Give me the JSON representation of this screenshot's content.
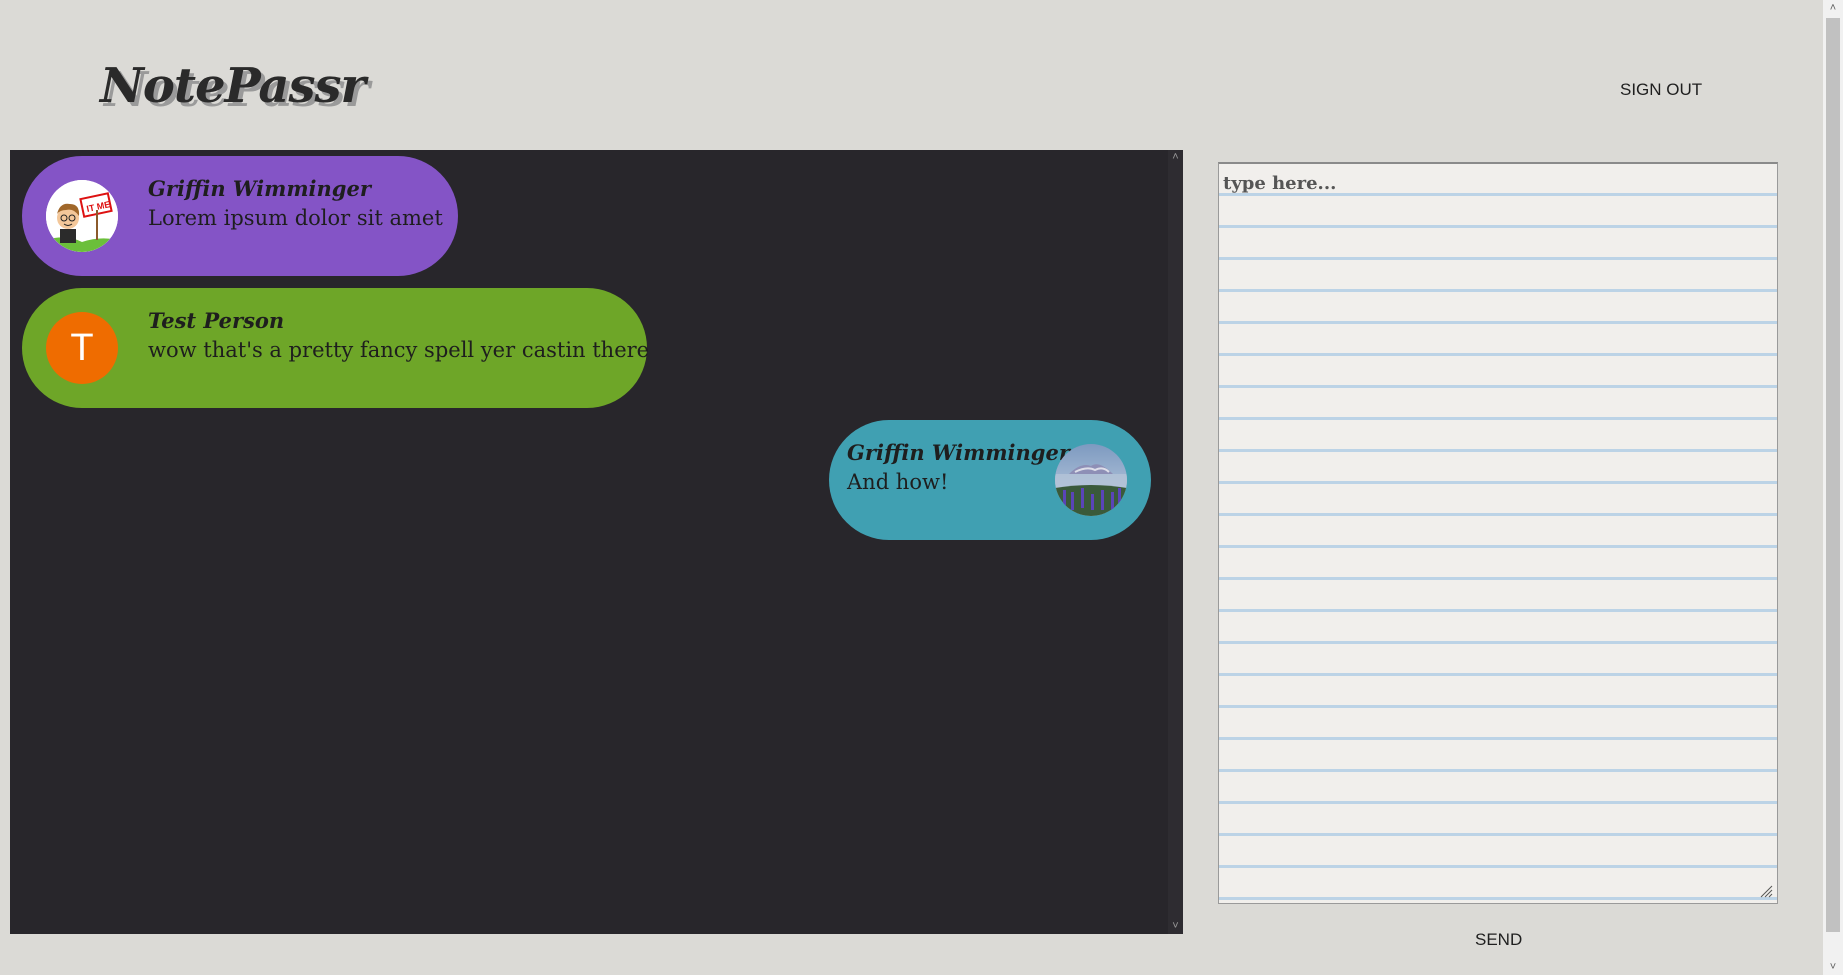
{
  "header": {
    "logo": "NotePassr",
    "signout_label": "SIGN OUT"
  },
  "messages": [
    {
      "author": "Griffin Wimminger",
      "text": "Lorem ipsum dolor sit amet",
      "color": "#8454c6",
      "avatar": "cartoon-it-me-avatar",
      "side": "left"
    },
    {
      "author": "Test Person",
      "text": "wow that's a pretty fancy spell yer castin there",
      "color": "#6ea628",
      "avatar_initial": "T",
      "avatar_color": "#ef6c00",
      "side": "left"
    },
    {
      "author": "Griffin Wimminger",
      "text": "And how!",
      "color": "#40a0b2",
      "avatar": "mountain-landscape-avatar",
      "side": "right"
    }
  ],
  "composer": {
    "placeholder": "type here...",
    "value": "",
    "send_label": "SEND"
  }
}
